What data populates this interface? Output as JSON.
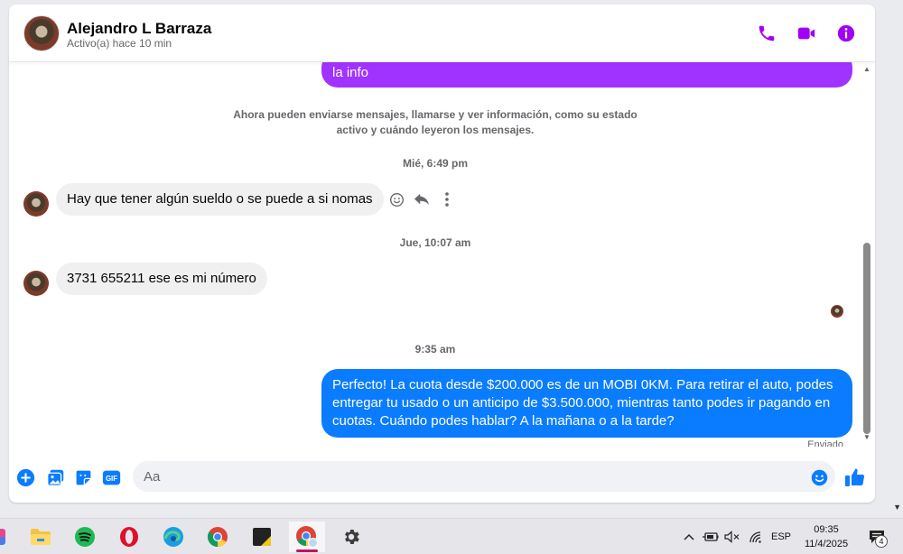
{
  "header": {
    "name": "Alejandro L Barraza",
    "status": "Activo(a) hace 10 min"
  },
  "messages": {
    "top_bubble_text": "la info",
    "system_note_line1": "Ahora pueden enviarse mensajes, llamarse y ver información, como su estado",
    "system_note_line2": "activo y cuándo leyeron los mensajes.",
    "ts1": "Mié, 6:49 pm",
    "msg1": "Hay que tener algún sueldo o se puede a si nomas",
    "ts2": "Jue, 10:07 am",
    "msg2": "3731 655211 ese es mi número",
    "ts3": "9:35 am",
    "out_line1": "Perfecto! La cuota desde $200.000 es de un MOBI 0KM. Para retirar el auto, podes",
    "out_line2": "entregar tu usado o un anticipo de $3.500.000, mientras tanto podes ir pagando en",
    "out_line3": "cuotas. Cuándo podes hablar? A la mañana o a la tarde?",
    "sent_status": "Enviado"
  },
  "composer": {
    "placeholder": "Aa"
  },
  "taskbar": {
    "language": "ESP",
    "time": "09:35",
    "date": "11/4/2025",
    "notification_count": "4"
  },
  "colors": {
    "messenger_purple": "#a033ff",
    "messenger_blue": "#0a7cff",
    "icon_purple": "#a100f2"
  }
}
